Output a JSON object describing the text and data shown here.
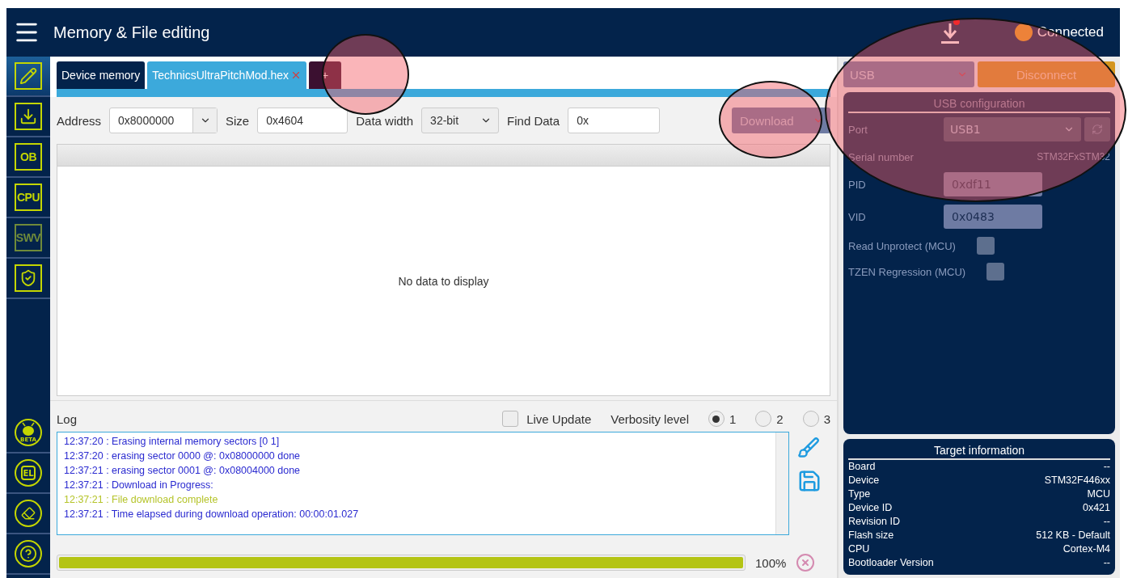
{
  "header": {
    "title": "Memory & File editing",
    "status": "Connected",
    "connected": true
  },
  "sidebar": {
    "top": [
      {
        "kind": "pencil",
        "selected": true
      },
      {
        "kind": "download",
        "selected": false
      },
      {
        "kind": "text",
        "label": "OB",
        "selected": false,
        "disabled": false
      },
      {
        "kind": "text",
        "label": "CPU",
        "selected": false,
        "disabled": false
      },
      {
        "kind": "text",
        "label": "SWV",
        "selected": false,
        "disabled": true
      },
      {
        "kind": "shield",
        "selected": false
      }
    ],
    "bottom": [
      {
        "kind": "bug",
        "label": "BETA"
      },
      {
        "kind": "chip",
        "label": "EL"
      },
      {
        "kind": "eraser"
      },
      {
        "kind": "help"
      }
    ]
  },
  "tabs": [
    {
      "label": "Device memory",
      "selected": false,
      "closable": false,
      "kind": "file"
    },
    {
      "label": "TechnicsUltraPitchMod.hex",
      "selected": true,
      "closable": true,
      "kind": "file"
    },
    {
      "label": "+",
      "selected": false,
      "closable": false,
      "kind": "add"
    }
  ],
  "toolbar": {
    "address": {
      "label": "Address",
      "value": "0x8000000"
    },
    "size": {
      "label": "Size",
      "value": "0x4604"
    },
    "data_width": {
      "label": "Data width",
      "value": "32-bit"
    },
    "find": {
      "label": "Find Data",
      "value": "0x"
    },
    "action": "Download"
  },
  "grid": {
    "empty_message": "No data to display"
  },
  "log": {
    "title": "Log",
    "live_update": {
      "label": "Live Update",
      "checked": false
    },
    "verbosity": {
      "label": "Verbosity level",
      "options": [
        {
          "label": "1",
          "selected": true
        },
        {
          "label": "2",
          "selected": false
        },
        {
          "label": "3",
          "selected": false
        }
      ]
    },
    "lines": [
      {
        "text": "12:37:20 : Erasing internal memory sectors [0 1]",
        "kind": "info"
      },
      {
        "text": "12:37:20 : erasing sector 0000 @: 0x08000000 done",
        "kind": "info"
      },
      {
        "text": "12:37:21 : erasing sector 0001 @: 0x08004000 done",
        "kind": "info"
      },
      {
        "text": "12:37:21 : Download in Progress:",
        "kind": "info"
      },
      {
        "text": "12:37:21 : File download complete",
        "kind": "success"
      },
      {
        "text": "12:37:21 : Time elapsed during download operation: 00:00:01.027",
        "kind": "info"
      }
    ],
    "progress": {
      "level": 1,
      "reading": "100%"
    }
  },
  "connection": {
    "interface": "USB",
    "button": "Disconnect"
  },
  "usb_config": {
    "title": "USB configuration",
    "port": {
      "label": "Port",
      "value": "USB1",
      "disabled": true
    },
    "serial": {
      "label": "Serial number",
      "value": "STM32FxSTM32"
    },
    "pid": {
      "label": "PID",
      "value": "0xdf11"
    },
    "vid": {
      "label": "VID",
      "value": "0x0483"
    },
    "checks": [
      {
        "label": "Read Unprotect (MCU)",
        "checked": false
      },
      {
        "label": "TZEN Regression (MCU)",
        "checked": false
      }
    ]
  },
  "target": {
    "title": "Target information",
    "rows": [
      {
        "label": "Board",
        "value": "--"
      },
      {
        "label": "Device",
        "value": "STM32F446xx"
      },
      {
        "label": "Type",
        "value": "MCU"
      },
      {
        "label": "Device ID",
        "value": "0x421"
      },
      {
        "label": "Revision ID",
        "value": "--"
      },
      {
        "label": "Flash size",
        "value": "512 KB - Default"
      },
      {
        "label": "CPU",
        "value": "Cortex-M4"
      },
      {
        "label": "Bootloader Version",
        "value": "--"
      }
    ]
  }
}
